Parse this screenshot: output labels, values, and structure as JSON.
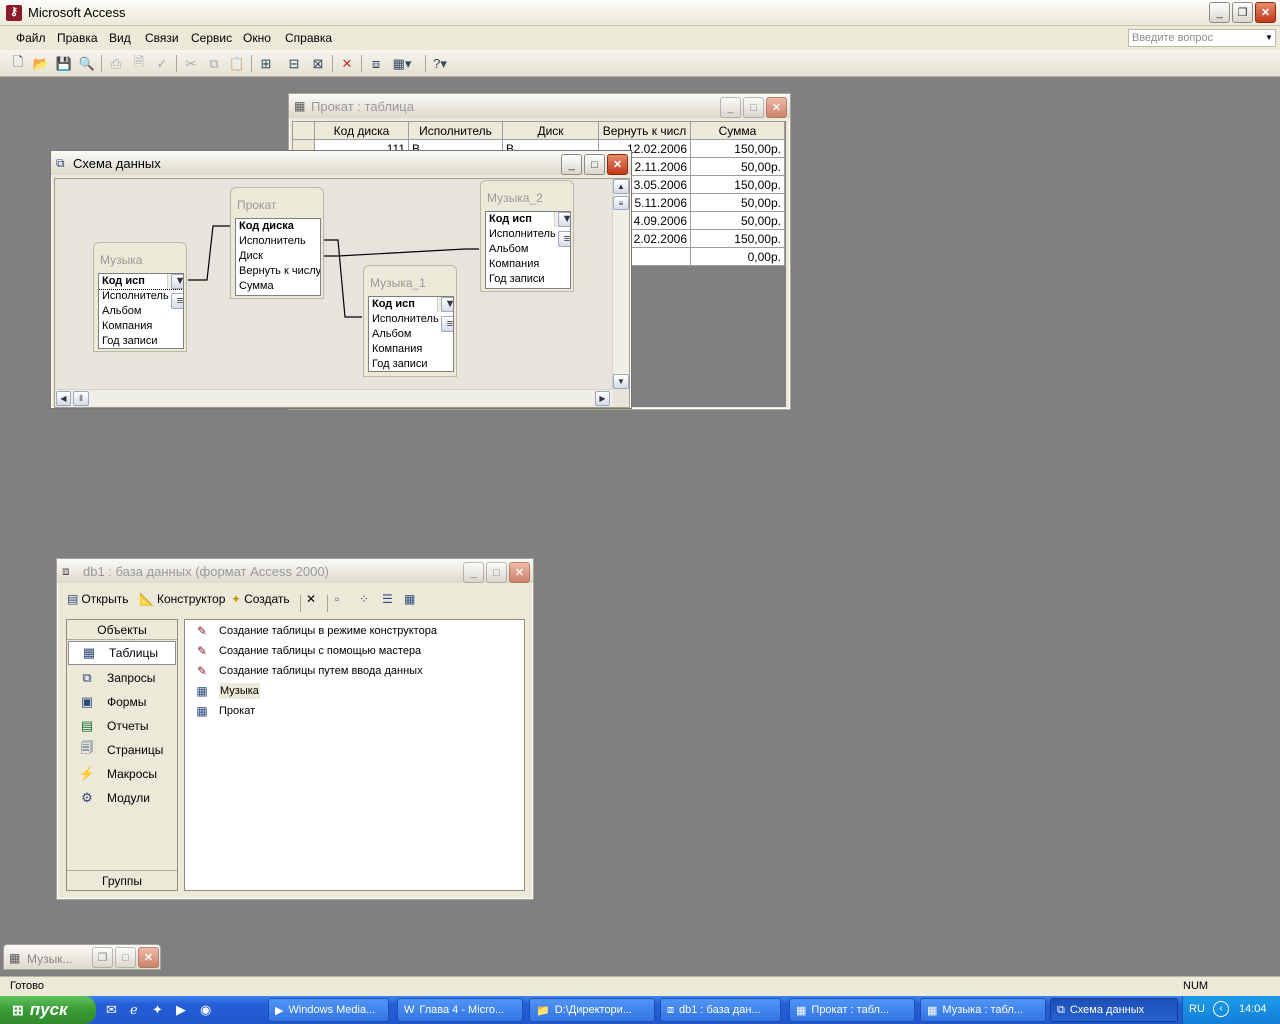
{
  "app": {
    "title": "Microsoft Access"
  },
  "menu": [
    "Файл",
    "Правка",
    "Вид",
    "Связи",
    "Сервис",
    "Окно",
    "Справка"
  ],
  "ask_placeholder": "Введите вопрос",
  "prokat": {
    "title": "Прокат : таблица",
    "columns": [
      "Код диска",
      "Исполнитель",
      "Диск",
      "Вернуть к числ",
      "Сумма"
    ],
    "rows": [
      [
        "111",
        "В",
        "В",
        "12.02.2006",
        "150,00р."
      ],
      [
        "",
        "",
        "",
        "2.11.2006",
        "50,00р."
      ],
      [
        "",
        "",
        "",
        "3.05.2006",
        "150,00р."
      ],
      [
        "",
        "",
        "",
        "5.11.2006",
        "50,00р."
      ],
      [
        "",
        "",
        "",
        "4.09.2006",
        "50,00р."
      ],
      [
        "",
        "",
        "",
        "2.02.2006",
        "150,00р."
      ],
      [
        "",
        "",
        "",
        "",
        "0,00р."
      ]
    ]
  },
  "schema": {
    "title": "Схема данных",
    "tables": {
      "muzyka": {
        "title": "Музыка",
        "fields": [
          "Код исп",
          "Исполнитель",
          "Альбом",
          "Компания",
          "Год записи"
        ]
      },
      "prokat": {
        "title": "Прокат",
        "fields": [
          "Код диска",
          "Исполнитель",
          "Диск",
          "Вернуть к числу",
          "Сумма"
        ]
      },
      "muzyka1": {
        "title": "Музыка_1",
        "fields": [
          "Код исп",
          "Исполнитель",
          "Альбом",
          "Компания",
          "Год записи"
        ]
      },
      "muzyka2": {
        "title": "Музыка_2",
        "fields": [
          "Код исп",
          "Исполнитель",
          "Альбом",
          "Компания",
          "Год записи"
        ]
      }
    }
  },
  "db": {
    "title": "db1 : база данных (формат Access 2000)",
    "toolbar": {
      "open": "Открыть",
      "design": "Конструктор",
      "create": "Создать"
    },
    "objects_header": "Объекты",
    "groups_header": "Группы",
    "objects": [
      "Таблицы",
      "Запросы",
      "Формы",
      "Отчеты",
      "Страницы",
      "Макросы",
      "Модули"
    ],
    "items": [
      "Создание таблицы в режиме конструктора",
      "Создание таблицы с помощью мастера",
      "Создание таблицы путем ввода данных",
      "Музыка",
      "Прокат"
    ]
  },
  "minimized": {
    "title": "Музык..."
  },
  "status": {
    "text": "Готово",
    "num": "NUM"
  },
  "taskbar": {
    "start": "пуск",
    "tasks": [
      "Windows Media...",
      "Глава 4 - Micro...",
      "D:\\Директори...",
      "db1 : база дан...",
      "Прокат : табл...",
      "Музыка : табл...",
      "Схема данных"
    ],
    "lang": "RU",
    "time": "14:04"
  }
}
